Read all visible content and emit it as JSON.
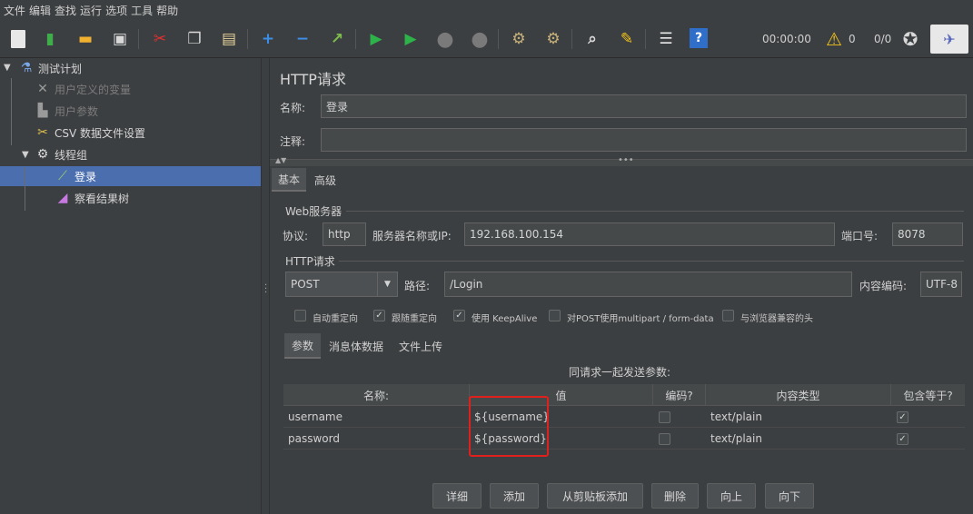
{
  "menu": [
    "文件",
    "编辑",
    "查找",
    "运行",
    "选项",
    "工具",
    "帮助"
  ],
  "toolbar": {
    "icons": [
      "new-plan-icon",
      "templates-icon",
      "open-icon",
      "save-icon",
      "cut-icon",
      "copy-icon",
      "paste-icon",
      "expand-icon",
      "collapse-icon",
      "toggle-icon",
      "start-icon",
      "start-no-pause-icon",
      "stop-icon",
      "shutdown-icon",
      "clear-icon",
      "clear-all-icon",
      "search-icon",
      "reset-search-icon",
      "function-helper-icon",
      "help-icon"
    ],
    "timer": "00:00:00",
    "warning_count": "0",
    "threads": "0/0"
  },
  "tree": {
    "items": [
      {
        "label": "测试计划",
        "icon": "flask-icon"
      },
      {
        "label": "用户定义的变量",
        "icon": "wrench-icon"
      },
      {
        "label": "用户参数",
        "icon": "params-icon"
      },
      {
        "label": "CSV 数据文件设置",
        "icon": "scissors-icon"
      },
      {
        "label": "线程组",
        "icon": "gear-icon"
      },
      {
        "label": "登录",
        "icon": "pipette-icon"
      },
      {
        "label": "察看结果树",
        "icon": "chart-icon"
      }
    ]
  },
  "panel": {
    "title": "HTTP请求",
    "name_label": "名称:",
    "name_value": "登录",
    "comment_label": "注释:",
    "comment_value": "",
    "tabs": [
      "基本",
      "高级"
    ],
    "web_server": {
      "legend": "Web服务器",
      "protocol_label": "协议:",
      "protocol": "http",
      "server_label": "服务器名称或IP:",
      "server": "192.168.100.154",
      "port_label": "端口号:",
      "port": "8078"
    },
    "http_request": {
      "legend": "HTTP请求",
      "method": "POST",
      "path_label": "路径:",
      "path": "/Login",
      "encoding_label": "内容编码:",
      "encoding": "UTF-8"
    },
    "options": [
      {
        "label": "自动重定向",
        "checked": false
      },
      {
        "label": "跟随重定向",
        "checked": true
      },
      {
        "label": "使用 KeepAlive",
        "checked": true
      },
      {
        "label": "对POST使用multipart / form-data",
        "checked": false
      },
      {
        "label": "与浏览器兼容的头",
        "checked": false
      }
    ],
    "sub_tabs": [
      "参数",
      "消息体数据",
      "文件上传"
    ],
    "params_caption": "同请求一起发送参数:",
    "table": {
      "headers": [
        "名称:",
        "值",
        "编码?",
        "内容类型",
        "包含等于?"
      ],
      "rows": [
        {
          "name": "username",
          "value": "${username}",
          "encode": false,
          "content_type": "text/plain",
          "include_equals": true
        },
        {
          "name": "password",
          "value": "${password}",
          "encode": false,
          "content_type": "text/plain",
          "include_equals": true
        }
      ]
    },
    "buttons": [
      "详细",
      "添加",
      "从剪贴板添加",
      "删除",
      "向上",
      "向下"
    ]
  }
}
